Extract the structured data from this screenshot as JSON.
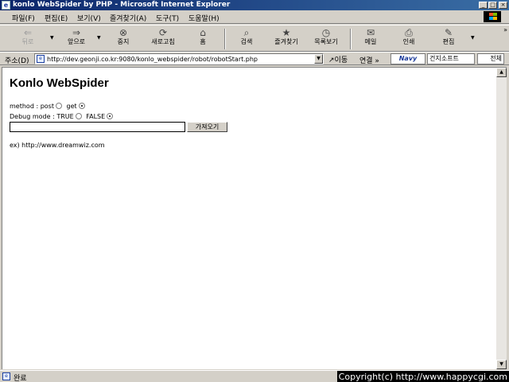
{
  "window": {
    "title": "konlo WebSpider by PHP - Microsoft Internet Explorer",
    "controls": [
      "_",
      "□",
      "×"
    ]
  },
  "menu": [
    "파일(F)",
    "편집(E)",
    "보기(V)",
    "즐겨찾기(A)",
    "도구(T)",
    "도움말(H)"
  ],
  "toolbar": {
    "back": {
      "label": "뒤로",
      "icon": "back-arrow-icon"
    },
    "forward": {
      "label": "앞으로",
      "icon": "forward-arrow-icon"
    },
    "stop": {
      "label": "중지",
      "icon": "stop-icon"
    },
    "refresh": {
      "label": "새로고침",
      "icon": "refresh-icon"
    },
    "home": {
      "label": "홈",
      "icon": "home-icon"
    },
    "search": {
      "label": "검색",
      "icon": "search-icon"
    },
    "favorites": {
      "label": "즐겨찾기",
      "icon": "favorites-icon"
    },
    "history": {
      "label": "목록보기",
      "icon": "history-icon"
    },
    "mail": {
      "label": "메일",
      "icon": "mail-icon"
    },
    "print": {
      "label": "인쇄",
      "icon": "print-icon"
    },
    "edit": {
      "label": "편집",
      "icon": "edit-icon"
    },
    "more": "»"
  },
  "address": {
    "label": "주소(D)",
    "url": "http://dev.geonji.co.kr:9080/konlo_webspider/robot/robotStart.php",
    "go_label": "이동",
    "links_label": "연결 »",
    "navy_label": "Navy",
    "navy_search": "건지소프트",
    "navy_scope": "전체"
  },
  "page": {
    "heading": "Konlo WebSpider",
    "method": {
      "label": "method :",
      "options": [
        "post",
        "get"
      ],
      "selected": "get"
    },
    "debug": {
      "label": "Debug mode :",
      "options": [
        "TRUE",
        "FALSE"
      ],
      "selected": "FALSE"
    },
    "url_input_value": "",
    "fetch_button": "가져오기",
    "example": "ex) http://www.dreamwiz.com"
  },
  "status": {
    "text": "완료",
    "copyright": "Copyright(c) http://www.happycgi.com"
  }
}
